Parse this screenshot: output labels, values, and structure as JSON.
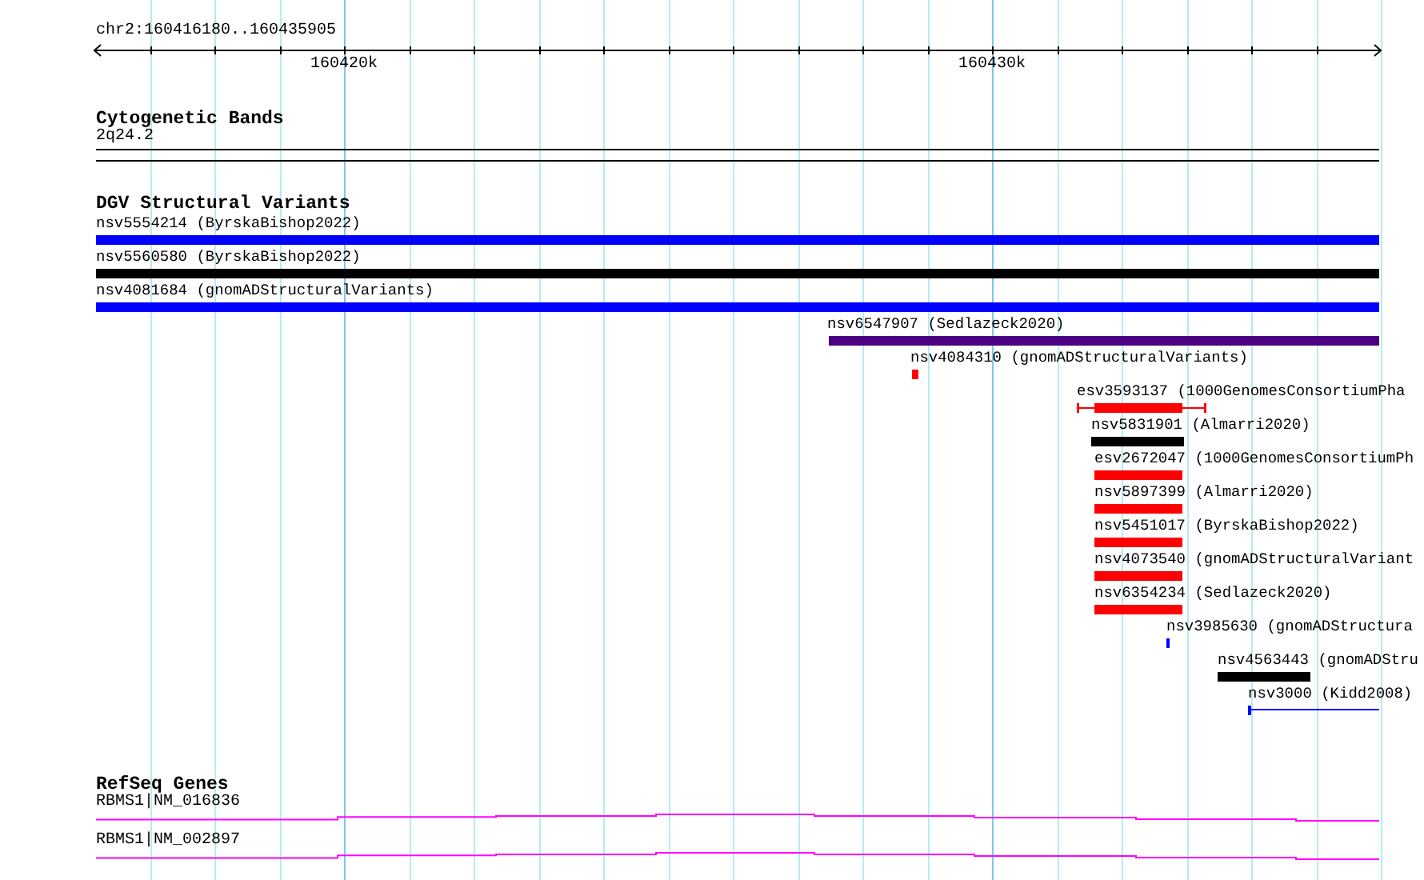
{
  "ruler": {
    "location": "chr2:160416180..160435905",
    "ticks": [
      {
        "label": "160420k"
      },
      {
        "label": "160430k"
      }
    ]
  },
  "tracks": [
    {
      "kind": "cytoband",
      "title": "Cytogenetic Bands",
      "features": [
        {
          "label": "2q24.2"
        }
      ]
    },
    {
      "kind": "variants",
      "title": "DGV Structural Variants",
      "features": [
        {
          "label": "nsv5554214 (ByrskaBishop2022)",
          "kind": "bar",
          "color": "#0000ff"
        },
        {
          "label": "nsv5560580 (ByrskaBishop2022)",
          "kind": "bar",
          "color": "#000000"
        },
        {
          "label": "nsv4081684 (gnomADStructuralVariants)",
          "kind": "bar",
          "color": "#0000ff"
        },
        {
          "label": "nsv6547907 (Sedlazeck2020)",
          "kind": "bar",
          "color": "#4b0082"
        },
        {
          "label": "nsv4084310 (gnomADStructuralVariants)",
          "kind": "bar",
          "color": "#ff0000"
        },
        {
          "label": "esv3593137 (1000GenomesConsortiumPha",
          "kind": "range",
          "color": "#ff0000"
        },
        {
          "label": "nsv5831901 (Almarri2020)",
          "kind": "bar",
          "color": "#000000"
        },
        {
          "label": "esv2672047 (1000GenomesConsortiumPh",
          "kind": "bar",
          "color": "#ff0000"
        },
        {
          "label": "nsv5897399 (Almarri2020)",
          "kind": "bar",
          "color": "#ff0000"
        },
        {
          "label": "nsv5451017 (ByrskaBishop2022)",
          "kind": "bar",
          "color": "#ff0000"
        },
        {
          "label": "nsv4073540 (gnomADStructuralVariant",
          "kind": "bar",
          "color": "#ff0000"
        },
        {
          "label": "nsv6354234 (Sedlazeck2020)",
          "kind": "bar",
          "color": "#ff0000"
        },
        {
          "label": "nsv3985630 (gnomADStructura",
          "kind": "bar",
          "color": "#0000ff"
        },
        {
          "label": "nsv4563443 (gnomADStru",
          "kind": "bar",
          "color": "#000000"
        },
        {
          "label": "nsv3000 (Kidd2008)",
          "kind": "line",
          "color": "#0000ff"
        }
      ]
    },
    {
      "kind": "genes",
      "title": "RefSeq Genes",
      "features": [
        {
          "label": "RBMS1|NM_016836"
        },
        {
          "label": "RBMS1|NM_002897"
        }
      ]
    }
  ]
}
